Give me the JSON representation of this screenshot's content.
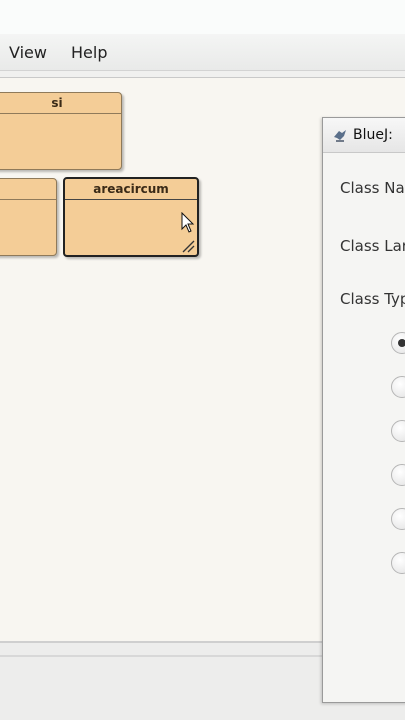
{
  "menubar": {
    "items": [
      "View",
      "Help"
    ]
  },
  "classes": [
    {
      "name": "si"
    },
    {
      "name": ""
    },
    {
      "name": "areacircum"
    }
  ],
  "dialog": {
    "title": "BlueJ:",
    "labels": {
      "class_name": "Class Na",
      "class_language": "Class Lar",
      "class_type": "Class Typ"
    },
    "radio_options": [
      {
        "selected": true
      },
      {
        "selected": false
      },
      {
        "selected": false
      },
      {
        "selected": false
      },
      {
        "selected": false
      },
      {
        "selected": false
      }
    ]
  },
  "colors": {
    "class_fill": "#f4cd97",
    "canvas": "#f8f6f1"
  }
}
